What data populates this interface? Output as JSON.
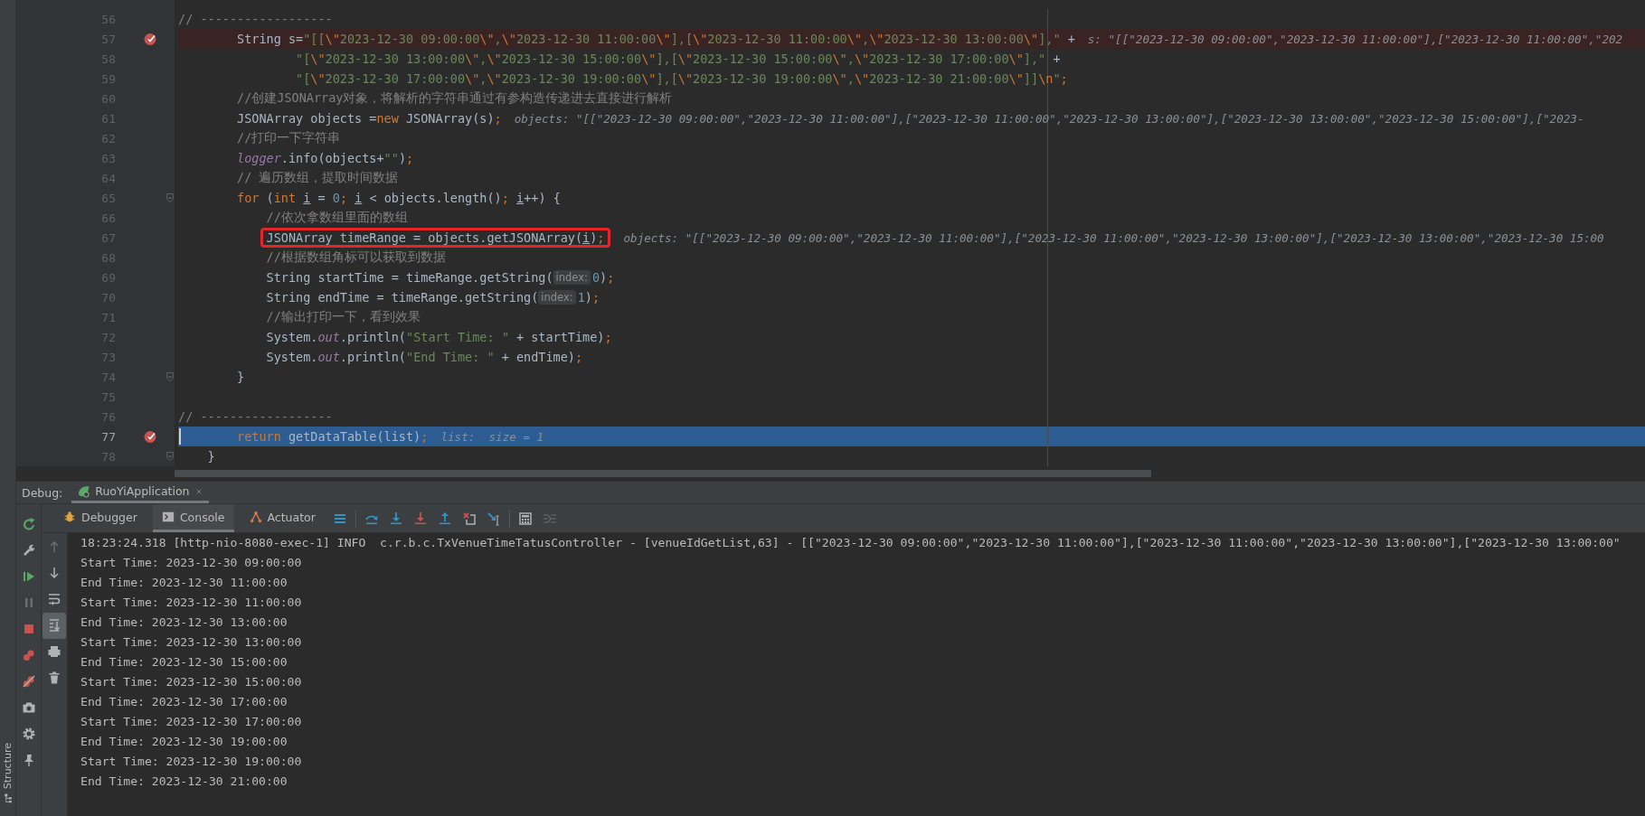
{
  "editor": {
    "lines": [
      {
        "number": "56",
        "breakpoint": false,
        "current": false,
        "boxed": false,
        "fold": false,
        "tokens": [
          {
            "kind": "comment",
            "text": "// ------------------"
          }
        ]
      },
      {
        "number": "57",
        "breakpoint": true,
        "current": false,
        "boxed": false,
        "fold": false,
        "tokens": [
          {
            "kind": "plain",
            "text": "        String s="
          },
          {
            "kind": "string",
            "text": "\"[[\\\"2023-12-30 09:00:00\\\",\\\"2023-12-30 11:00:00\\\"],[\\\"2023-12-30 11:00:00\\\",\\\"2023-12-30 13:00:00\\\"],\""
          },
          {
            "kind": "plain",
            "text": " +"
          }
        ],
        "hint": "s: \"[[\"2023-12-30 09:00:00\",\"2023-12-30 11:00:00\"],[\"2023-12-30 11:00:00\",\"202"
      },
      {
        "number": "58",
        "breakpoint": false,
        "current": false,
        "boxed": false,
        "fold": false,
        "tokens": [
          {
            "kind": "string",
            "text": "                \"[\\\"2023-12-30 13:00:00\\\",\\\"2023-12-30 15:00:00\\\"],[\\\"2023-12-30 15:00:00\\\",\\\"2023-12-30 17:00:00\\\"],\""
          },
          {
            "kind": "plain",
            "text": " +"
          }
        ]
      },
      {
        "number": "59",
        "breakpoint": false,
        "current": false,
        "boxed": false,
        "fold": false,
        "tokens": [
          {
            "kind": "string",
            "text": "                \"[\\\"2023-12-30 17:00:00\\\",\\\"2023-12-30 19:00:00\\\"],[\\\"2023-12-30 19:00:00\\\",\\\"2023-12-30 21:00:00\\\"]]\\n\""
          },
          {
            "kind": "keyword",
            "text": ";"
          }
        ]
      },
      {
        "number": "60",
        "breakpoint": false,
        "current": false,
        "boxed": false,
        "fold": false,
        "tokens": [
          {
            "kind": "comment",
            "text": "        //创建JSONArray对象，将解析的字符串通过有参构造传递进去直接进行解析"
          }
        ]
      },
      {
        "number": "61",
        "breakpoint": false,
        "current": false,
        "boxed": false,
        "fold": false,
        "tokens": [
          {
            "kind": "plain",
            "text": "        JSONArray objects ="
          },
          {
            "kind": "keyword",
            "text": "new"
          },
          {
            "kind": "plain",
            "text": " JSONArray(s)"
          },
          {
            "kind": "keyword",
            "text": ";"
          }
        ],
        "hint": "objects: \"[[\"2023-12-30 09:00:00\",\"2023-12-30 11:00:00\"],[\"2023-12-30 11:00:00\",\"2023-12-30 13:00:00\"],[\"2023-12-30 13:00:00\",\"2023-12-30 15:00:00\"],[\"2023-"
      },
      {
        "number": "62",
        "breakpoint": false,
        "current": false,
        "boxed": false,
        "fold": false,
        "tokens": [
          {
            "kind": "comment",
            "text": "        //打印一下字符串"
          }
        ]
      },
      {
        "number": "63",
        "breakpoint": false,
        "current": false,
        "boxed": false,
        "fold": false,
        "tokens": [
          {
            "kind": "field",
            "text": "        logger"
          },
          {
            "kind": "plain",
            "text": ".info(objects+"
          },
          {
            "kind": "string",
            "text": "\"\""
          },
          {
            "kind": "plain",
            "text": ")"
          },
          {
            "kind": "keyword",
            "text": ";"
          }
        ]
      },
      {
        "number": "64",
        "breakpoint": false,
        "current": false,
        "boxed": false,
        "fold": false,
        "tokens": [
          {
            "kind": "comment",
            "text": "        // 遍历数组，提取时间数据"
          }
        ]
      },
      {
        "number": "65",
        "breakpoint": false,
        "current": false,
        "boxed": false,
        "fold": true,
        "tokens": [
          {
            "kind": "keyword",
            "text": "        for"
          },
          {
            "kind": "plain",
            "text": " ("
          },
          {
            "kind": "keyword",
            "text": "int "
          },
          {
            "kind": "underline",
            "text": "i"
          },
          {
            "kind": "plain",
            "text": " = "
          },
          {
            "kind": "number",
            "text": "0"
          },
          {
            "kind": "keyword",
            "text": "; "
          },
          {
            "kind": "underline",
            "text": "i"
          },
          {
            "kind": "plain",
            "text": " < objects.length()"
          },
          {
            "kind": "keyword",
            "text": "; "
          },
          {
            "kind": "underline",
            "text": "i"
          },
          {
            "kind": "plain",
            "text": "++) {"
          }
        ]
      },
      {
        "number": "66",
        "breakpoint": false,
        "current": false,
        "boxed": false,
        "fold": false,
        "tokens": [
          {
            "kind": "comment",
            "text": "            //依次拿数组里面的数组"
          }
        ]
      },
      {
        "number": "67",
        "breakpoint": false,
        "current": false,
        "boxed": true,
        "fold": false,
        "tokens": [
          {
            "kind": "plain",
            "text": "            JSONArray timeRange = objects.getJSONArray("
          },
          {
            "kind": "underline",
            "text": "i"
          },
          {
            "kind": "plain",
            "text": ")"
          },
          {
            "kind": "keyword",
            "text": ";"
          }
        ],
        "hint": "objects: \"[[\"2023-12-30 09:00:00\",\"2023-12-30 11:00:00\"],[\"2023-12-30 11:00:00\",\"2023-12-30 13:00:00\"],[\"2023-12-30 13:00:00\",\"2023-12-30 15:00"
      },
      {
        "number": "68",
        "breakpoint": false,
        "current": false,
        "boxed": false,
        "fold": false,
        "tokens": [
          {
            "kind": "comment",
            "text": "            //根据数组角标可以获取到数据"
          }
        ]
      },
      {
        "number": "69",
        "breakpoint": false,
        "current": false,
        "boxed": false,
        "fold": false,
        "tokens": [
          {
            "kind": "plain",
            "text": "            String startTime = timeRange.getString("
          },
          {
            "kind": "inlay",
            "text": "index:"
          },
          {
            "kind": "number",
            "text": "0"
          },
          {
            "kind": "plain",
            "text": ")"
          },
          {
            "kind": "keyword",
            "text": ";"
          }
        ]
      },
      {
        "number": "70",
        "breakpoint": false,
        "current": false,
        "boxed": false,
        "fold": false,
        "tokens": [
          {
            "kind": "plain",
            "text": "            String endTime = timeRange.getString("
          },
          {
            "kind": "inlay",
            "text": "index:"
          },
          {
            "kind": "number",
            "text": "1"
          },
          {
            "kind": "plain",
            "text": ")"
          },
          {
            "kind": "keyword",
            "text": ";"
          }
        ]
      },
      {
        "number": "71",
        "breakpoint": false,
        "current": false,
        "boxed": false,
        "fold": false,
        "tokens": [
          {
            "kind": "comment",
            "text": "            //输出打印一下，看到效果"
          }
        ]
      },
      {
        "number": "72",
        "breakpoint": false,
        "current": false,
        "boxed": false,
        "fold": false,
        "tokens": [
          {
            "kind": "plain",
            "text": "            System."
          },
          {
            "kind": "field",
            "text": "out"
          },
          {
            "kind": "plain",
            "text": ".println("
          },
          {
            "kind": "string",
            "text": "\"Start Time: \""
          },
          {
            "kind": "plain",
            "text": " + startTime)"
          },
          {
            "kind": "keyword",
            "text": ";"
          }
        ]
      },
      {
        "number": "73",
        "breakpoint": false,
        "current": false,
        "boxed": false,
        "fold": false,
        "tokens": [
          {
            "kind": "plain",
            "text": "            System."
          },
          {
            "kind": "field",
            "text": "out"
          },
          {
            "kind": "plain",
            "text": ".println("
          },
          {
            "kind": "string",
            "text": "\"End Time: \""
          },
          {
            "kind": "plain",
            "text": " + endTime)"
          },
          {
            "kind": "keyword",
            "text": ";"
          }
        ]
      },
      {
        "number": "74",
        "breakpoint": false,
        "current": false,
        "boxed": false,
        "fold": true,
        "tokens": [
          {
            "kind": "plain",
            "text": "        }"
          }
        ]
      },
      {
        "number": "75",
        "breakpoint": false,
        "current": false,
        "boxed": false,
        "fold": false
      },
      {
        "number": "76",
        "breakpoint": false,
        "current": false,
        "boxed": false,
        "fold": false,
        "tokens": [
          {
            "kind": "comment",
            "text": "// ------------------"
          }
        ]
      },
      {
        "number": "77",
        "breakpoint": true,
        "current": true,
        "boxed": false,
        "fold": false,
        "tokens": [
          {
            "kind": "keyword",
            "text": "        return"
          },
          {
            "kind": "plain",
            "text": " getDataTable(list)"
          },
          {
            "kind": "keyword",
            "text": ";"
          }
        ],
        "hint": "list:  size = 1"
      },
      {
        "number": "78",
        "breakpoint": false,
        "current": false,
        "boxed": false,
        "fold": true,
        "tokens": [
          {
            "kind": "plain",
            "text": "    }"
          }
        ]
      }
    ]
  },
  "debug": {
    "label": "Debug:",
    "tabs": [
      {
        "label": "RuoYiApplication",
        "selected": true
      }
    ],
    "view_tabs": [
      {
        "kind": "debugger",
        "label": "Debugger",
        "selected": false
      },
      {
        "kind": "console",
        "label": "Console",
        "selected": true
      },
      {
        "kind": "actuator",
        "label": "Actuator",
        "selected": false
      }
    ],
    "toolbar": [
      {
        "kind": "layout",
        "disabled": false
      },
      {
        "kind": "step-over",
        "disabled": false
      },
      {
        "kind": "step-into",
        "disabled": false
      },
      {
        "kind": "force-step-into",
        "disabled": false
      },
      {
        "kind": "step-out",
        "disabled": false
      },
      {
        "kind": "drop-frame",
        "disabled": false
      },
      {
        "kind": "run-to-cursor",
        "disabled": false
      },
      {
        "kind": "evaluate",
        "disabled": false
      },
      {
        "kind": "trace",
        "disabled": true
      }
    ],
    "side_actions": [
      {
        "kind": "rerun",
        "disabled": false
      },
      {
        "kind": "wrench",
        "disabled": false
      },
      {
        "kind": "resume",
        "disabled": false
      },
      {
        "kind": "pause",
        "disabled": true
      },
      {
        "kind": "stop",
        "disabled": false
      },
      {
        "kind": "breakpoints",
        "disabled": false
      },
      {
        "kind": "mute",
        "disabled": false
      },
      {
        "kind": "camera",
        "disabled": false
      },
      {
        "kind": "gear",
        "disabled": false
      },
      {
        "kind": "pin",
        "disabled": false
      }
    ],
    "console_actions": [
      {
        "kind": "up",
        "disabled": true,
        "on": false
      },
      {
        "kind": "down",
        "disabled": false,
        "on": false
      },
      {
        "kind": "wrap",
        "disabled": false,
        "on": false
      },
      {
        "kind": "scroll-end",
        "disabled": false,
        "on": true
      },
      {
        "kind": "print",
        "disabled": false,
        "on": false
      },
      {
        "kind": "trash",
        "disabled": false,
        "on": false
      }
    ],
    "console": [
      "18:23:24.318 [http-nio-8080-exec-1] INFO  c.r.b.c.TxVenueTimeTatusController - [venueIdGetList,63] - [[\"2023-12-30 09:00:00\",\"2023-12-30 11:00:00\"],[\"2023-12-30 11:00:00\",\"2023-12-30 13:00:00\"],[\"2023-12-30 13:00:00\"",
      "Start Time: 2023-12-30 09:00:00",
      "End Time: 2023-12-30 11:00:00",
      "Start Time: 2023-12-30 11:00:00",
      "End Time: 2023-12-30 13:00:00",
      "Start Time: 2023-12-30 13:00:00",
      "End Time: 2023-12-30 15:00:00",
      "Start Time: 2023-12-30 15:00:00",
      "End Time: 2023-12-30 17:00:00",
      "Start Time: 2023-12-30 17:00:00",
      "End Time: 2023-12-30 19:00:00",
      "Start Time: 2023-12-30 19:00:00",
      "End Time: 2023-12-30 21:00:00"
    ]
  },
  "side_strip": {
    "label": "Structure"
  }
}
